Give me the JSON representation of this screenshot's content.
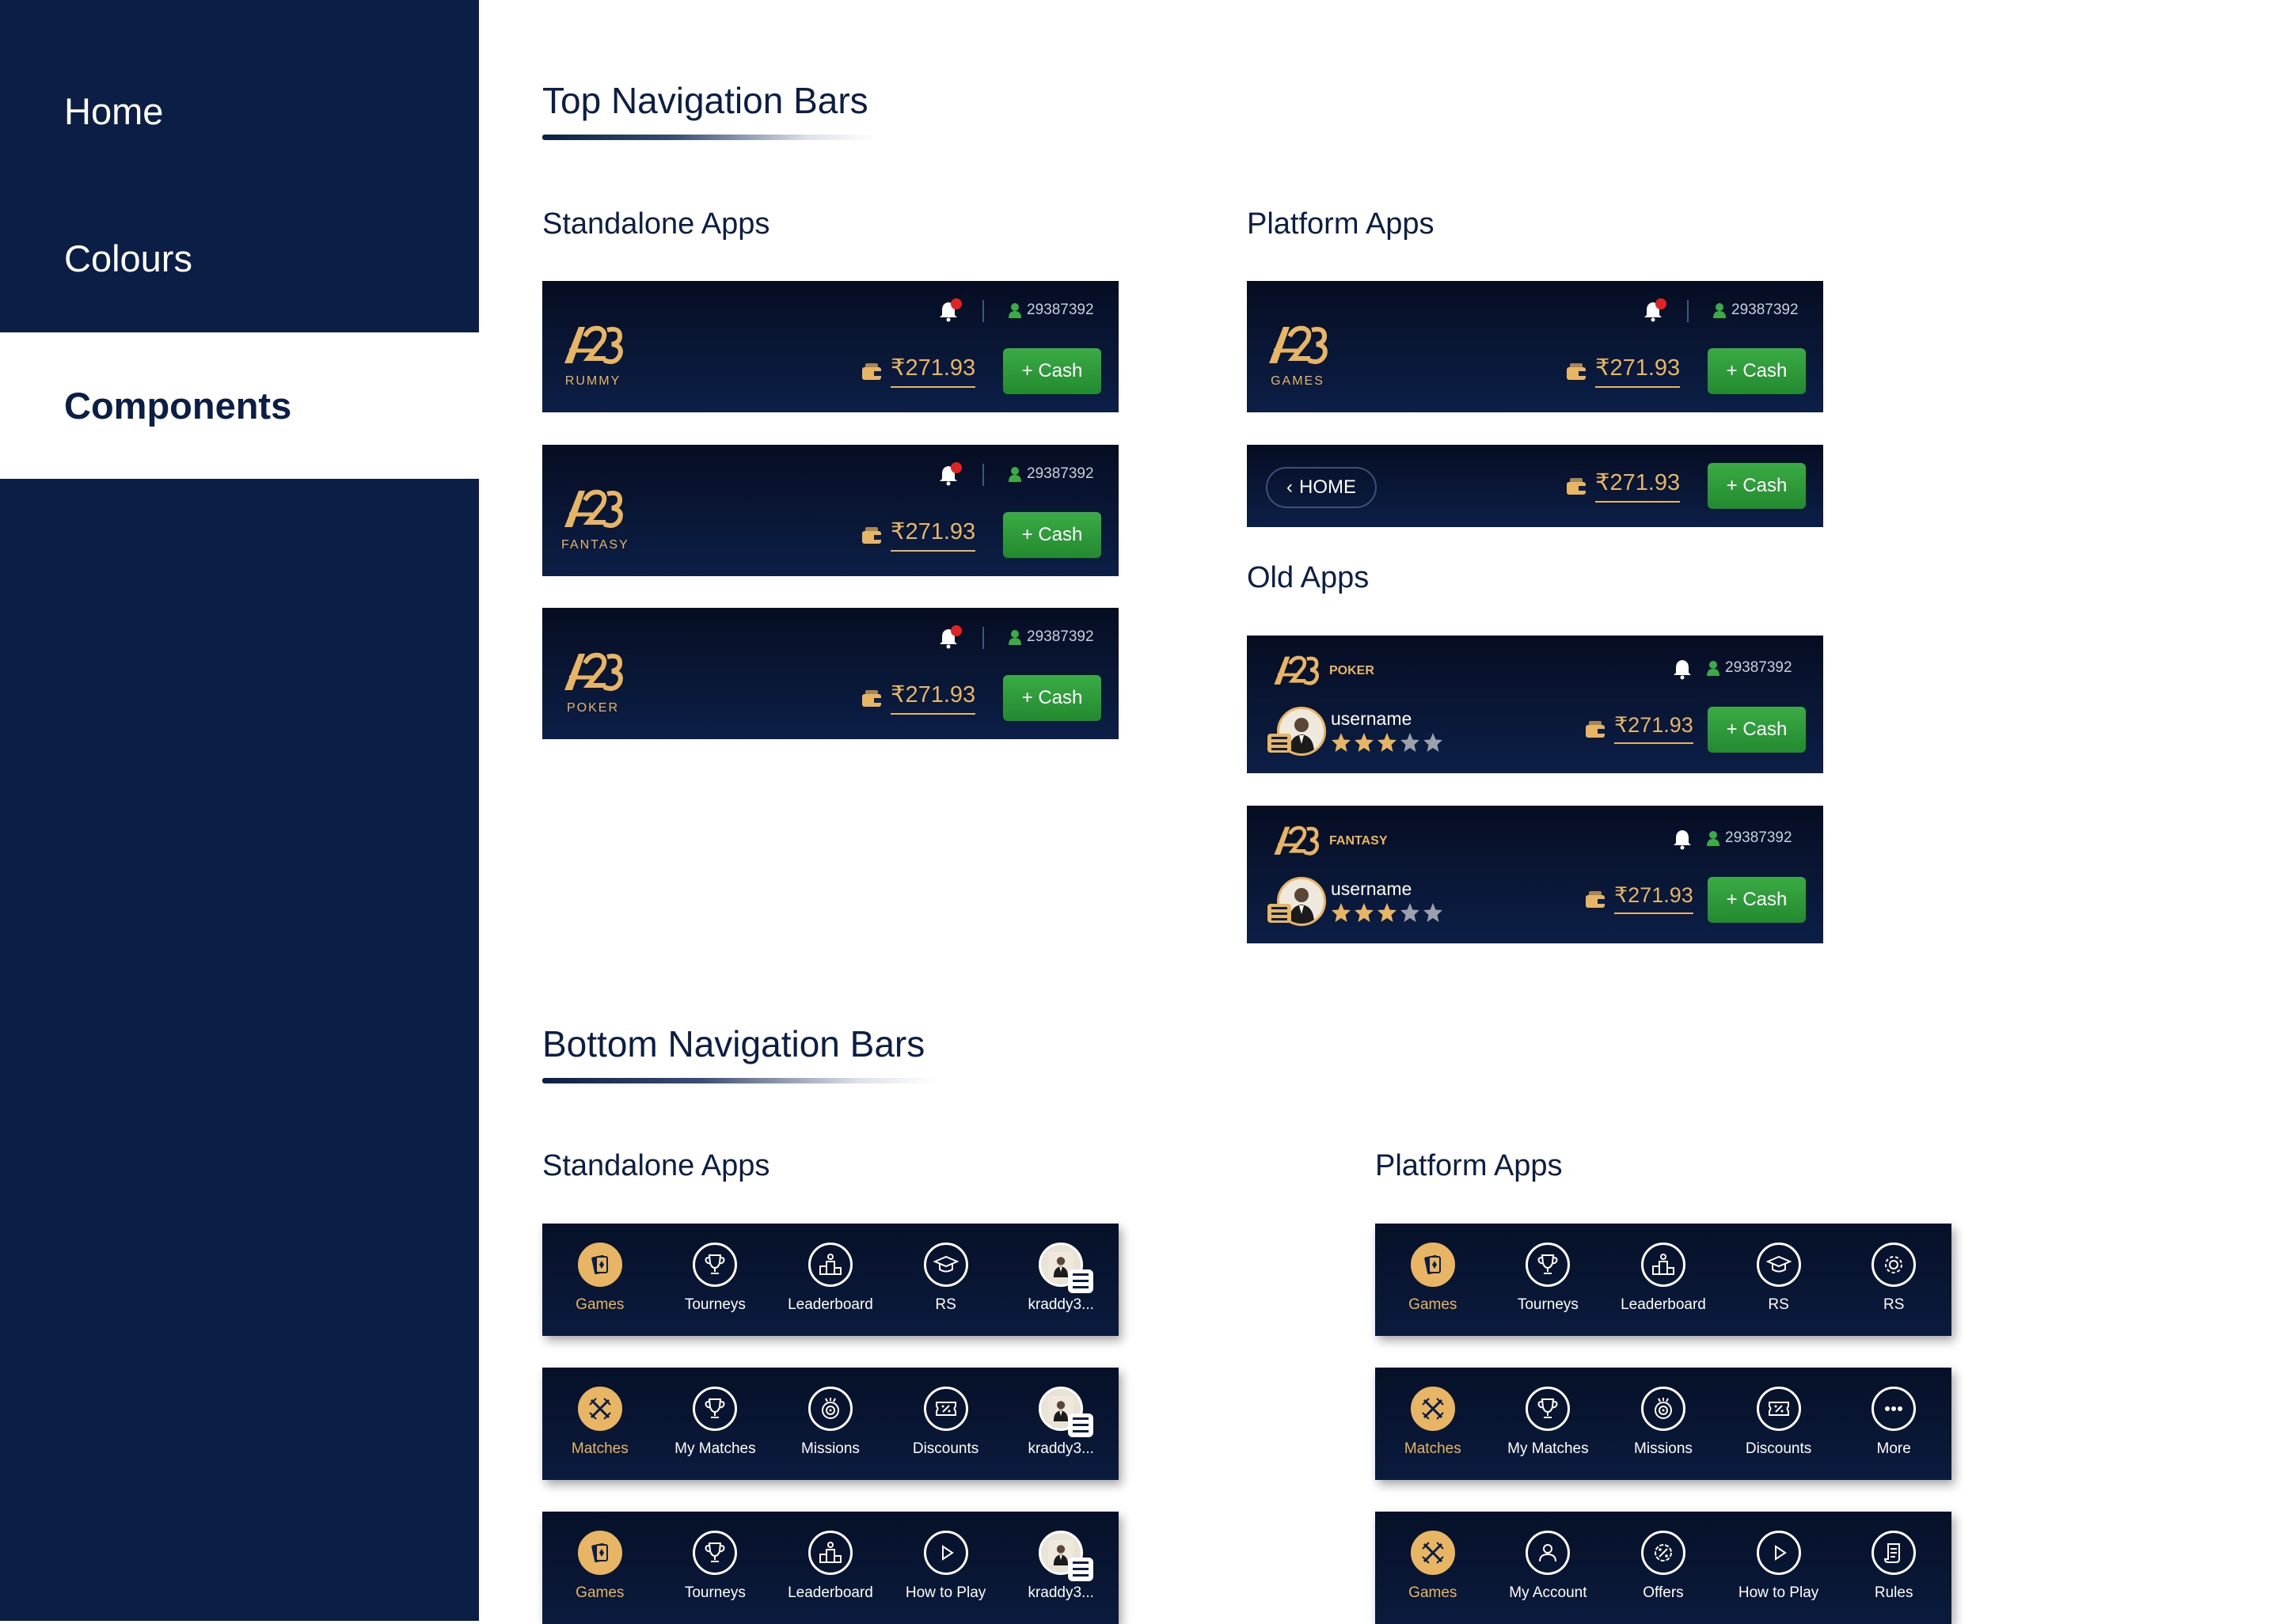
{
  "sidebar": {
    "items": [
      {
        "label": "Home"
      },
      {
        "label": "Colours"
      },
      {
        "label": "Components"
      }
    ]
  },
  "top_section": {
    "title": "Top Navigation Bars",
    "standalone_title": "Standalone Apps",
    "platform_title": "Platform Apps",
    "old_title": "Old Apps"
  },
  "bottom_section": {
    "title": "Bottom Navigation Bars",
    "standalone_title": "Standalone Apps",
    "platform_title": "Platform Apps"
  },
  "topbars": {
    "user_id": "29387392",
    "amount": "₹271.93",
    "cash_label": "+ Cash",
    "home_label": "HOME",
    "rummy_logo": "RUMMY",
    "fantasy_logo": "FANTASY",
    "poker_logo": "POKER",
    "games_logo": "GAMES",
    "old_poker": "POKER",
    "old_fantasy": "FANTASY",
    "username": "username",
    "rating": 3,
    "rating_max": 5
  },
  "bottombars": {
    "standalone_1": [
      "Games",
      "Tourneys",
      "Leaderboard",
      "RS",
      "kraddy3..."
    ],
    "standalone_2": [
      "Matches",
      "My Matches",
      "Missions",
      "Discounts",
      "kraddy3..."
    ],
    "standalone_3": [
      "Games",
      "Tourneys",
      "Leaderboard",
      "How to Play",
      "kraddy3..."
    ],
    "platform_1": [
      "Games",
      "Tourneys",
      "Leaderboard",
      "RS",
      "RS"
    ],
    "platform_2": [
      "Matches",
      "My Matches",
      "Missions",
      "Discounts",
      "More"
    ],
    "platform_3": [
      "Games",
      "My Account",
      "Offers",
      "How to Play",
      "Rules"
    ]
  },
  "colors": {
    "navy": "#0b1e45",
    "gold": "#e7b563",
    "green": "#2f9b3a"
  }
}
